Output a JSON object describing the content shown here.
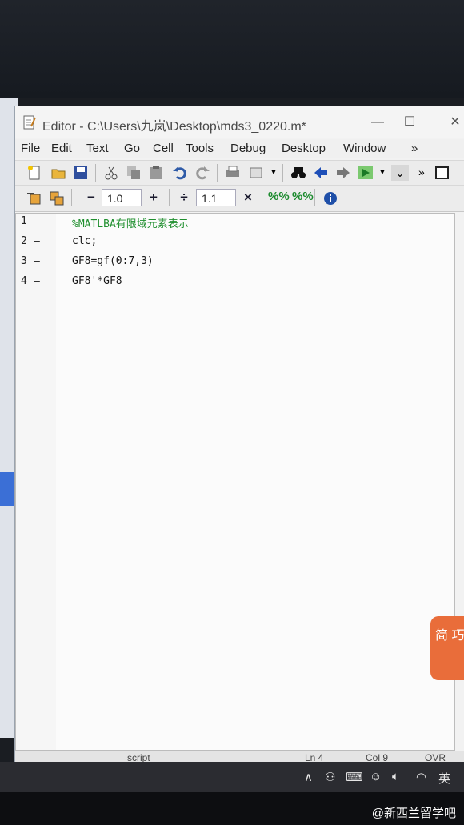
{
  "window": {
    "title": "Editor - C:\\Users\\九岚\\Desktop\\mds3_0220.m*",
    "minimize": "—",
    "maximize": "☐",
    "close": "✕"
  },
  "menu": [
    "File",
    "Edit",
    "Text",
    "Go",
    "Cell",
    "Tools",
    "Debug",
    "Desktop",
    "Window"
  ],
  "menu_more": "»",
  "cell_toolbar": {
    "minus": "−",
    "value1": "1.0",
    "plus": "+",
    "divide": "÷",
    "value2": "1.1",
    "times": "×"
  },
  "code_lines": [
    {
      "num": "1",
      "marker": "",
      "text": "%MATLBA有限域元素表示",
      "is_comment": true
    },
    {
      "num": "2",
      "marker": "—",
      "text": "clc;",
      "is_comment": false
    },
    {
      "num": "3",
      "marker": "—",
      "text": "GF8=gf(0:7,3)",
      "is_comment": false
    },
    {
      "num": "4",
      "marker": "—",
      "text": "GF8'*GF8",
      "is_comment": false
    }
  ],
  "status": {
    "mode": "script",
    "ln": "Ln  4",
    "col": "Col  9",
    "ovr": "OVR"
  },
  "tray": {
    "ime": "英"
  },
  "widget_label": "简 巧",
  "watermark": "@新西兰留学吧",
  "colors": {
    "comment": "#1f8f2e",
    "background": "#fbfbfb"
  }
}
